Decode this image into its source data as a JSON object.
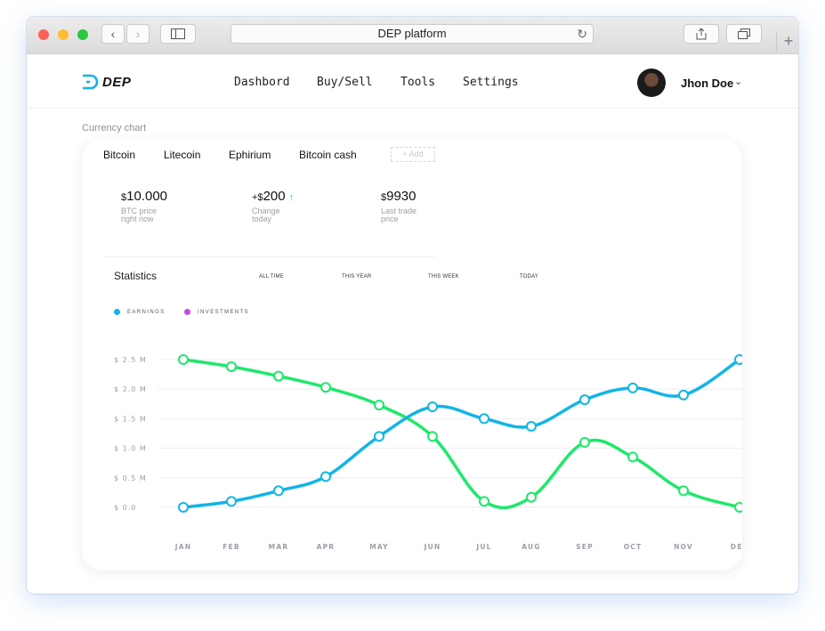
{
  "browser": {
    "url_title": "DEP platform",
    "reload_glyph": "↻",
    "back_glyph": "‹",
    "forward_glyph": "›",
    "new_tab_glyph": "+"
  },
  "header": {
    "logo_text": "DEP",
    "nav": [
      "Dashbord",
      "Buy/Sell",
      "Tools",
      "Settings"
    ],
    "user_name": "Jhon Doe",
    "chevron": "⌄"
  },
  "section_title": "Currency chart",
  "currency_tabs": [
    "Bitcoin",
    "Litecoin",
    "Ephirium",
    "Bitcoin cash"
  ],
  "add_label": "+ Add",
  "stats": [
    {
      "prefix": "",
      "currency": "$",
      "value": "10.000",
      "arrow": "",
      "line1": "BTC price",
      "line2": "right now"
    },
    {
      "prefix": "+",
      "currency": "$",
      "value": "200",
      "arrow": "↑",
      "line1": "Change",
      "line2": "today"
    },
    {
      "prefix": "",
      "currency": "$",
      "value": "9930",
      "arrow": "",
      "line1": "Last trade",
      "line2": "price"
    }
  ],
  "statistics": {
    "title": "Statistics",
    "periods": [
      "ALL TIME",
      "THIS YEAR",
      "THIS WEEK",
      "TODAY"
    ]
  },
  "chart_data": {
    "type": "line",
    "title": "",
    "x": [
      "JAN",
      "FEB",
      "MAR",
      "APR",
      "MAY",
      "JUN",
      "JUL",
      "AUG",
      "SEP",
      "OCT",
      "NOV",
      "DEC"
    ],
    "y_ticks": [
      "$ 0.0",
      "$ 0.5 M",
      "$ 1.0 M",
      "$ 1.5 M",
      "$ 2.0 M",
      "$ 2.5 M"
    ],
    "ylim": [
      0,
      2.5
    ],
    "grid": true,
    "legend_position": "top-left",
    "series": [
      {
        "name": "EARNINGS",
        "color": "#12b5e5",
        "values": [
          0.0,
          0.1,
          0.28,
          0.52,
          1.2,
          1.7,
          1.5,
          1.37,
          1.82,
          2.02,
          1.9,
          2.5
        ]
      },
      {
        "name": "INVESTMENTS",
        "color": "#c14ce0",
        "values": []
      },
      {
        "name": "",
        "color": "#1ee86a",
        "values": [
          2.5,
          2.38,
          2.22,
          2.03,
          1.73,
          1.2,
          0.1,
          0.17,
          1.1,
          0.85,
          0.28,
          0.0
        ]
      }
    ]
  }
}
